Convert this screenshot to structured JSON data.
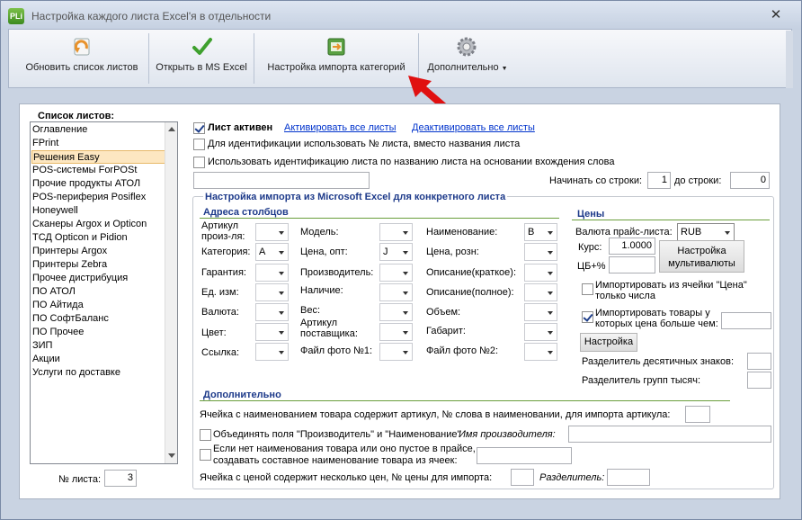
{
  "window": {
    "title": "Настройка каждого листа Excel'я в отдельности",
    "app_icon_text": "PLi",
    "close_glyph": "✕"
  },
  "toolbar": {
    "refresh_label": "Обновить список листов",
    "open_excel_label": "Открыть в MS Excel",
    "import_categories_label": "Настройка импорта категорий",
    "more_label": "Дополнительно"
  },
  "sheets": {
    "title": "Список листов:",
    "items": [
      "Оглавление",
      "FPrint",
      "Решения Easy",
      "POS-системы ForPOSt",
      "Прочие продукты АТОЛ",
      "POS-периферия Posiflex",
      "Honeywell",
      "Сканеры Argox и Opticon",
      "ТСД Opticon и Pidion",
      "Принтеры Argox",
      "Принтеры Zebra",
      "Прочее дистрибуция",
      "ПО АТОЛ",
      "ПО Айтида",
      "ПО СофтБаланс",
      "ПО Прочее",
      "ЗИП",
      "Акции",
      "Услуги по доставке"
    ],
    "selected": "Решения Easy",
    "number_label": "№ листа:",
    "number_value": "3"
  },
  "options": {
    "active_label": "Лист активен",
    "activate_all": "Активировать все листы",
    "deactivate_all": "Деактивировать все листы",
    "use_number_label": "Для идентификации использовать № листа, вместо названия листа",
    "use_occurrence_label": "Использовать идентификацию листа по названию листа на основании вхождения слова",
    "occurrence_value": "",
    "start_row_label": "Начинать со строки:",
    "start_row_value": "1",
    "end_row_label": "до строки:",
    "end_row_value": "0"
  },
  "import": {
    "group_title": "Настройка импорта из Microsoft Excel для конкретного листа",
    "columns_title": "Адреса столбцов",
    "prices_title": "Цены",
    "col1": [
      {
        "label": "Артикул произ-ля:",
        "value": ""
      },
      {
        "label": "Категория:",
        "value": "A"
      },
      {
        "label": "Гарантия:",
        "value": ""
      },
      {
        "label": "Ед. изм:",
        "value": ""
      },
      {
        "label": "Валюта:",
        "value": ""
      },
      {
        "label": "Цвет:",
        "value": ""
      },
      {
        "label": "Ссылка:",
        "value": ""
      }
    ],
    "col2": [
      {
        "label": "Модель:",
        "value": ""
      },
      {
        "label": "Цена, опт:",
        "value": "J"
      },
      {
        "label": "Производитель:",
        "value": ""
      },
      {
        "label": "Наличие:",
        "value": ""
      },
      {
        "label": "Вес:",
        "value": ""
      },
      {
        "label": "Артикул поставщика:",
        "value": ""
      },
      {
        "label": "Файл фото №1:",
        "value": ""
      }
    ],
    "col3": [
      {
        "label": "Наименование:",
        "value": "B"
      },
      {
        "label": "Цена, розн:",
        "value": ""
      },
      {
        "label": "Описание(краткое):",
        "value": ""
      },
      {
        "label": "Описание(полное):",
        "value": ""
      },
      {
        "label": "Объем:",
        "value": ""
      },
      {
        "label": "Габарит:",
        "value": ""
      },
      {
        "label": "Файл фото №2:",
        "value": ""
      }
    ]
  },
  "prices": {
    "currency_label": "Валюта прайс-листа:",
    "currency_value": "RUB",
    "rate_label": "Курс:",
    "rate_value": "1.0000",
    "cb_label": "ЦБ+%",
    "cb_value": "",
    "multicurrency_btn": "Настройка мультивалюты",
    "import_numbers_label": "Импортировать из ячейки \"Цена\" только числа",
    "import_greater_label": "Импортировать товары у которых цена больше чем:",
    "import_greater_value": "",
    "settings_btn": "Настройка",
    "decimal_sep_label": "Разделитель десятичных знаков:",
    "decimal_sep_value": "",
    "group_sep_label": "Разделитель групп тысяч:",
    "group_sep_value": ""
  },
  "extra": {
    "title": "Дополнительно",
    "article_in_name_label": "Ячейка с наименованием товара содержит артикул, № слова в наименовании, для импорта артикула:",
    "article_in_name_value": "",
    "merge_fields_label": "Объединять поля \"Производитель\" и \"Наименование\"",
    "manufacturer_name_label": "Имя производителя:",
    "manufacturer_name_value": "",
    "composite_name_label": "Если нет наименования товара или оно пустое в прайсе, создавать составное наименование товара из ячеек:",
    "composite_name_value": "",
    "multi_price_label": "Ячейка с ценой содержит несколько цен, № цены для импорта:",
    "multi_price_value": "",
    "separator_label": "Разделитель:",
    "separator_value": ""
  }
}
